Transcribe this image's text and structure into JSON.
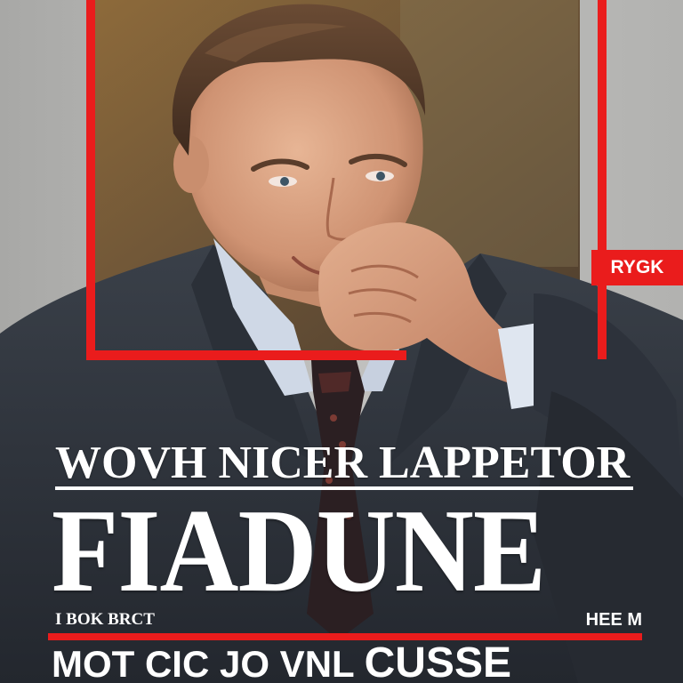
{
  "cover": {
    "corner_tag": "RYGK",
    "headline": "WOVH NICER LAPPETOR",
    "masthead": "FIADUNE",
    "small_left": "I BOK BRCT",
    "small_right": "HEE M",
    "bottom_text": "MOT CIC JO VNL",
    "bottom_big": "CUSSE"
  },
  "colors": {
    "accent_red": "#ea1c1c",
    "text": "#ffffff",
    "background": "#b9b9b7",
    "suit": "#2d323b",
    "shirt": "#cfd8e6"
  }
}
